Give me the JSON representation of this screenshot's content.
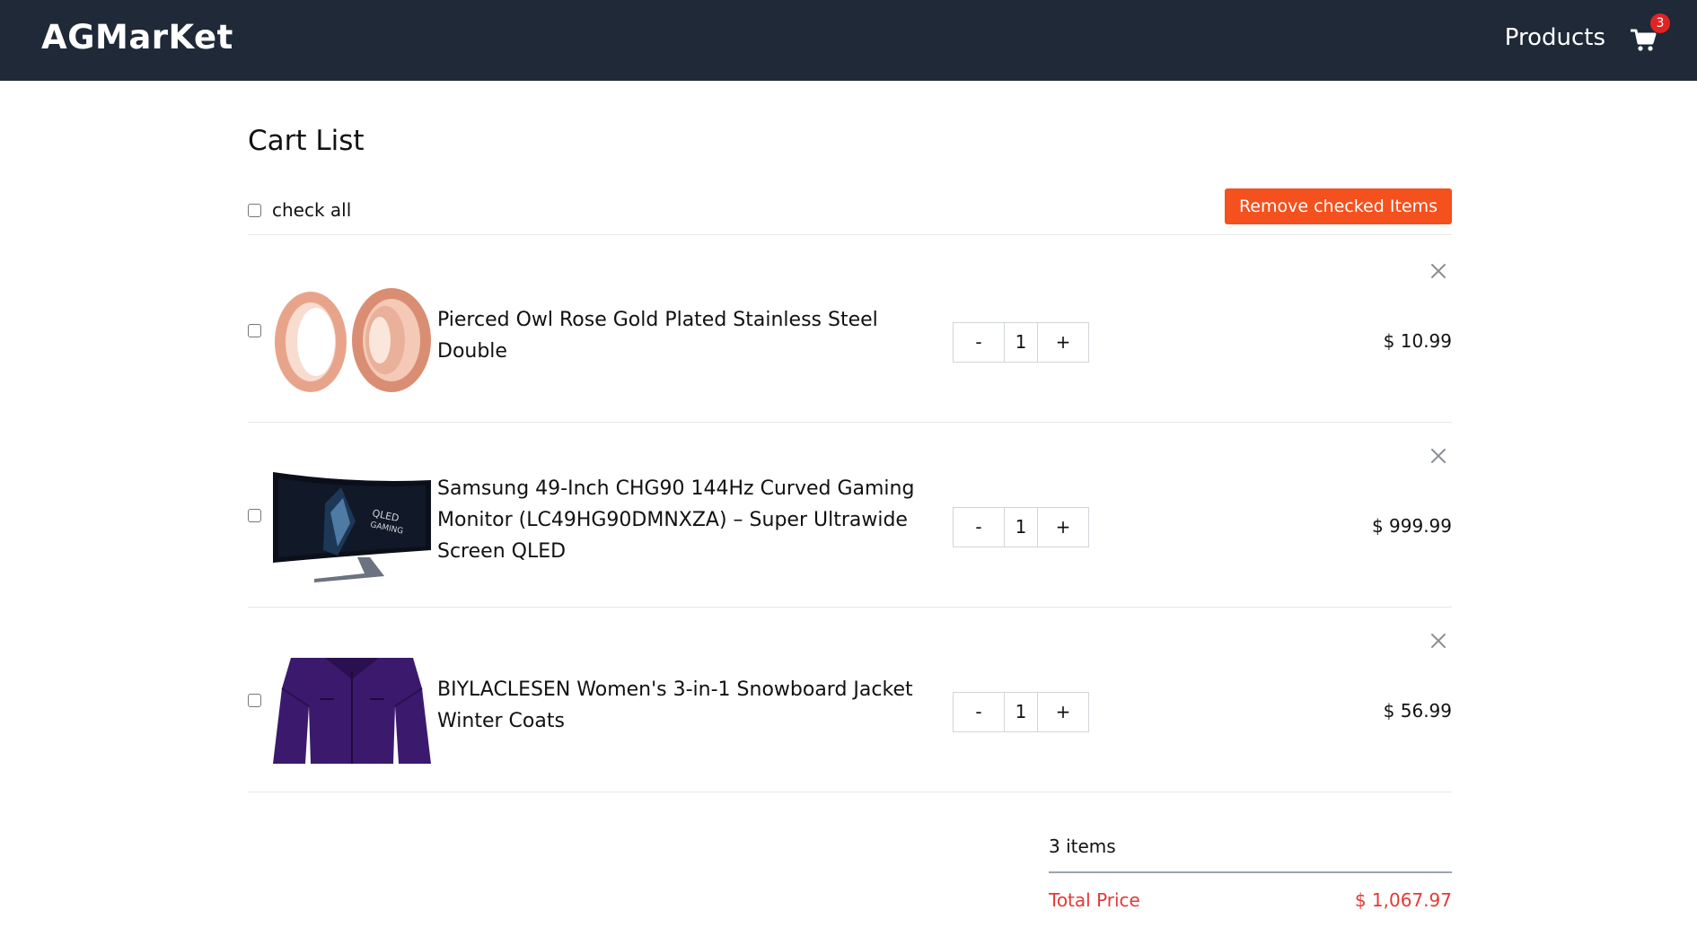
{
  "navbar": {
    "brand": "AGMarKet",
    "products_link": "Products",
    "cart_count": "3"
  },
  "page": {
    "title": "Cart List",
    "check_all_label": "check all",
    "remove_checked_label": "Remove checked Items"
  },
  "items": [
    {
      "title": "Pierced Owl Rose Gold Plated Stainless Steel Double",
      "image_icon": "rose-gold-ear-plugs",
      "minus": "-",
      "quantity": "1",
      "plus": "+",
      "price": "$ 10.99"
    },
    {
      "title": "Samsung 49-Inch CHG90 144Hz Curved Gaming Monitor (LC49HG90DMNXZA) – Super Ultrawide Screen QLED",
      "image_icon": "curved-monitor",
      "minus": "-",
      "quantity": "1",
      "plus": "+",
      "price": "$ 999.99"
    },
    {
      "title": "BIYLACLESEN Women's 3-in-1 Snowboard Jacket Winter Coats",
      "image_icon": "purple-jacket",
      "minus": "-",
      "quantity": "1",
      "plus": "+",
      "price": "$ 56.99"
    }
  ],
  "summary": {
    "item_count": "3 items",
    "total_label": "Total Price",
    "total_value": "$ 1,067.97"
  },
  "colors": {
    "navbar_bg": "#1f2937",
    "accent": "#f4511e",
    "badge": "#e02424",
    "total_text": "#e53935"
  }
}
